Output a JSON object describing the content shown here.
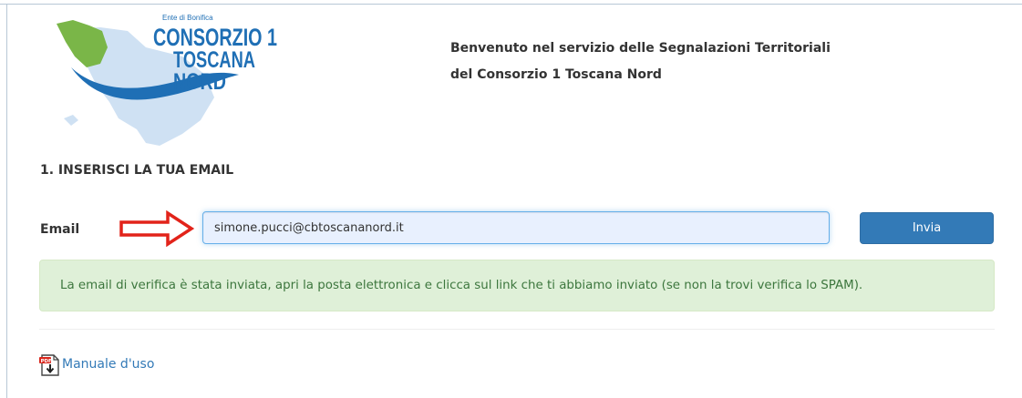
{
  "logo": {
    "small_text": "Ente di Bonifica",
    "line1": "CONSORZIO 1",
    "line2": "TOSCANA",
    "line3": "NORD"
  },
  "header": {
    "welcome_line1": "Benvenuto nel servizio delle Segnalazioni Territoriali",
    "welcome_line2": "del Consorzio 1 Toscana Nord"
  },
  "form": {
    "section_title": "1. INSERISCI LA TUA EMAIL",
    "email_label": "Email",
    "email_value": "simone.pucci@cbtoscananord.it",
    "submit_label": "Invia"
  },
  "alert": {
    "message": "La email di verifica è stata inviata, apri la posta elettronica e clicca sul link che ti abbiamo inviato (se non la trovi verifica lo SPAM)."
  },
  "footer": {
    "manual_label": "Manuale d'uso"
  },
  "colors": {
    "primary": "#337ab7",
    "success_bg": "#dff0d8",
    "success_text": "#3c763d",
    "arrow": "#e2231a",
    "logo_blue": "#1f6fb5",
    "logo_green": "#7ab648"
  },
  "icons": {
    "arrow": "right-arrow-outline-icon",
    "manual": "pdf-download-icon"
  }
}
